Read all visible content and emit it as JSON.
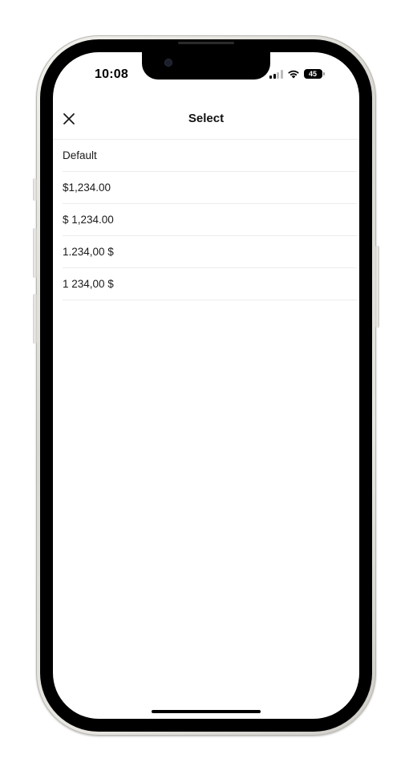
{
  "status_bar": {
    "time": "10:08",
    "battery": "45"
  },
  "header": {
    "title": "Select",
    "close_icon": "close-icon"
  },
  "options": [
    {
      "label": "Default"
    },
    {
      "label": "$1,234.00"
    },
    {
      "label": "$ 1,234.00"
    },
    {
      "label": "1.234,00 $"
    },
    {
      "label": "1 234,00 $"
    }
  ],
  "colors": {
    "background": "#ffffff",
    "text": "#1a1a1a",
    "divider": "#ececec",
    "phone_frame": "#000000"
  }
}
